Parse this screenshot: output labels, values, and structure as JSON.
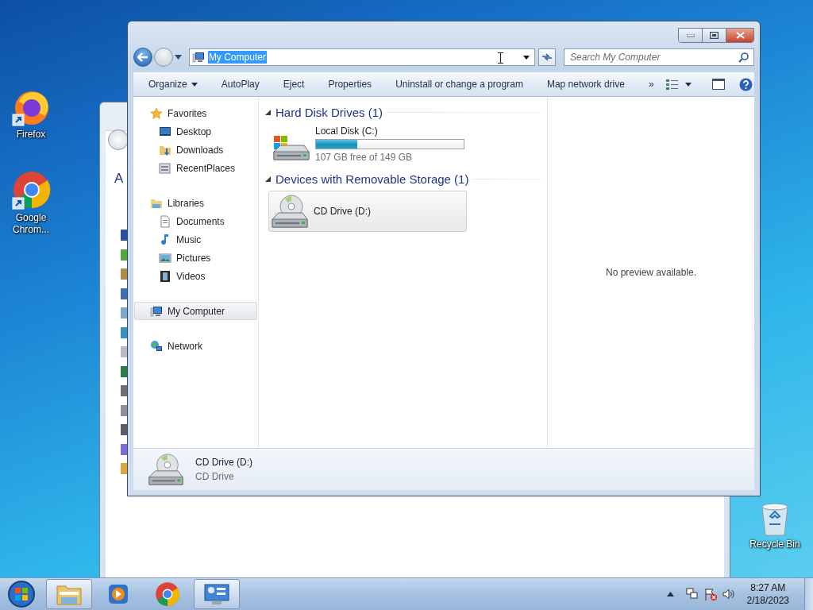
{
  "desktop_icons": [
    {
      "kind": "firefox",
      "label": "Firefox"
    },
    {
      "kind": "chrome",
      "label": "Google Chrom..."
    }
  ],
  "recycle_bin": {
    "label": "Recycle Bin"
  },
  "background_window": {
    "heading": "A"
  },
  "explorer": {
    "address": {
      "value": "My Computer",
      "text_selected": true
    },
    "search": {
      "placeholder": "Search My Computer"
    },
    "commands": [
      {
        "kind": "menu",
        "label": "Organize"
      },
      {
        "kind": "button",
        "label": "AutoPlay"
      },
      {
        "kind": "button",
        "label": "Eject"
      },
      {
        "kind": "button",
        "label": "Properties"
      },
      {
        "kind": "button",
        "label": "Uninstall or change a program"
      },
      {
        "kind": "button",
        "label": "Map network drive"
      },
      {
        "kind": "button",
        "label": "»"
      }
    ],
    "nav": [
      {
        "kind": "favorites",
        "label": "Favorites",
        "selected": false,
        "children": [
          {
            "kind": "desktop",
            "label": "Desktop",
            "selected": false
          },
          {
            "kind": "downloads",
            "label": "Downloads",
            "selected": false
          },
          {
            "kind": "recent",
            "label": "RecentPlaces",
            "selected": false
          }
        ]
      },
      {
        "kind": "libraries",
        "label": "Libraries",
        "selected": false,
        "children": [
          {
            "kind": "documents",
            "label": "Documents",
            "selected": false
          },
          {
            "kind": "music",
            "label": "Music",
            "selected": false
          },
          {
            "kind": "pictures",
            "label": "Pictures",
            "selected": false
          },
          {
            "kind": "videos",
            "label": "Videos",
            "selected": false
          }
        ]
      },
      {
        "kind": "computer",
        "label": "My Computer",
        "selected": true
      },
      {
        "kind": "network",
        "label": "Network",
        "selected": false
      }
    ],
    "groups": [
      {
        "title": "Hard Disk Drives (1)",
        "expanded": true,
        "items": [
          {
            "kind": "disk",
            "name": "Local Disk (C:)",
            "level": 0.28,
            "free": "107 GB free of 149 GB",
            "selected": false
          }
        ]
      },
      {
        "title": "Devices with Removable Storage (1)",
        "expanded": true,
        "items": [
          {
            "kind": "cd",
            "name": "CD Drive (D:)",
            "selected": true
          }
        ]
      }
    ],
    "preview": {
      "message": "No preview available."
    },
    "details": {
      "kind": "cd",
      "name": "CD Drive (D:)",
      "type": "CD Drive"
    }
  },
  "taskbar": {
    "apps": [
      {
        "kind": "explorer",
        "running": true
      },
      {
        "kind": "media",
        "running": false
      },
      {
        "kind": "chrome",
        "running": false
      },
      {
        "kind": "control",
        "running": true
      }
    ],
    "clock": {
      "time": "8:27 AM",
      "date": "2/18/2023"
    }
  }
}
